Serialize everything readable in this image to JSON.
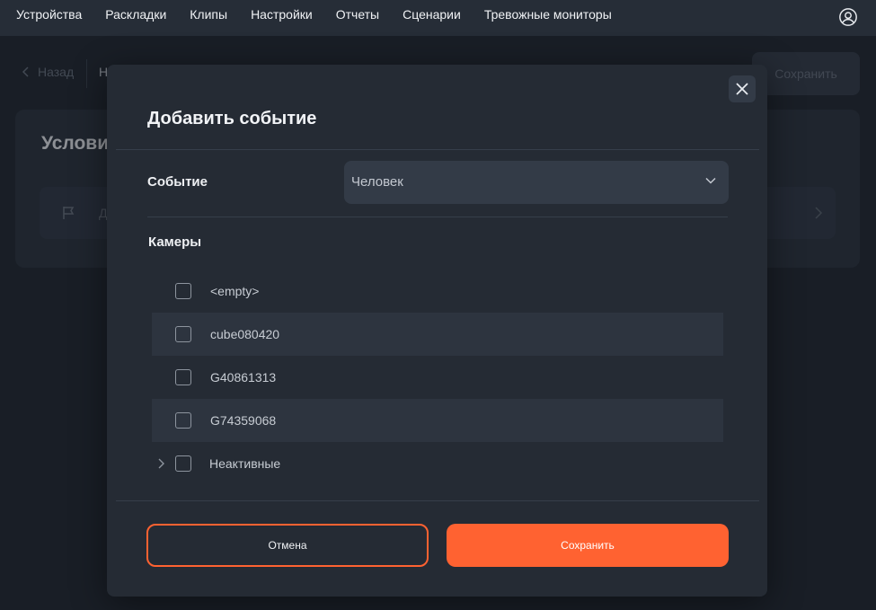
{
  "nav": {
    "items": [
      "Устройства",
      "Раскладки",
      "Клипы",
      "Настройки",
      "Отчеты",
      "Сценарии",
      "Тревожные мониторы"
    ],
    "user_icon": "user-circle-icon"
  },
  "background": {
    "back_label": "Назад",
    "breadcrumb": "Н",
    "save_label": "Сохранить",
    "card_title": "Услови",
    "row_text": "Д"
  },
  "modal": {
    "title": "Добавить событие",
    "event_label": "Событие",
    "event_value": "Человек",
    "cameras_label": "Камеры",
    "cameras": [
      {
        "label": "<empty>",
        "checked": false
      },
      {
        "label": "cube080420",
        "checked": false
      },
      {
        "label": "G40861313",
        "checked": false
      },
      {
        "label": "G74359068",
        "checked": false
      }
    ],
    "inactive_group": {
      "label": "Неактивные",
      "checked": false,
      "expanded": false
    },
    "cancel_label": "Отмена",
    "save_label": "Сохранить"
  },
  "colors": {
    "accent": "#ff6231",
    "modal_bg": "#252b34",
    "page_bg": "#1f252e"
  }
}
